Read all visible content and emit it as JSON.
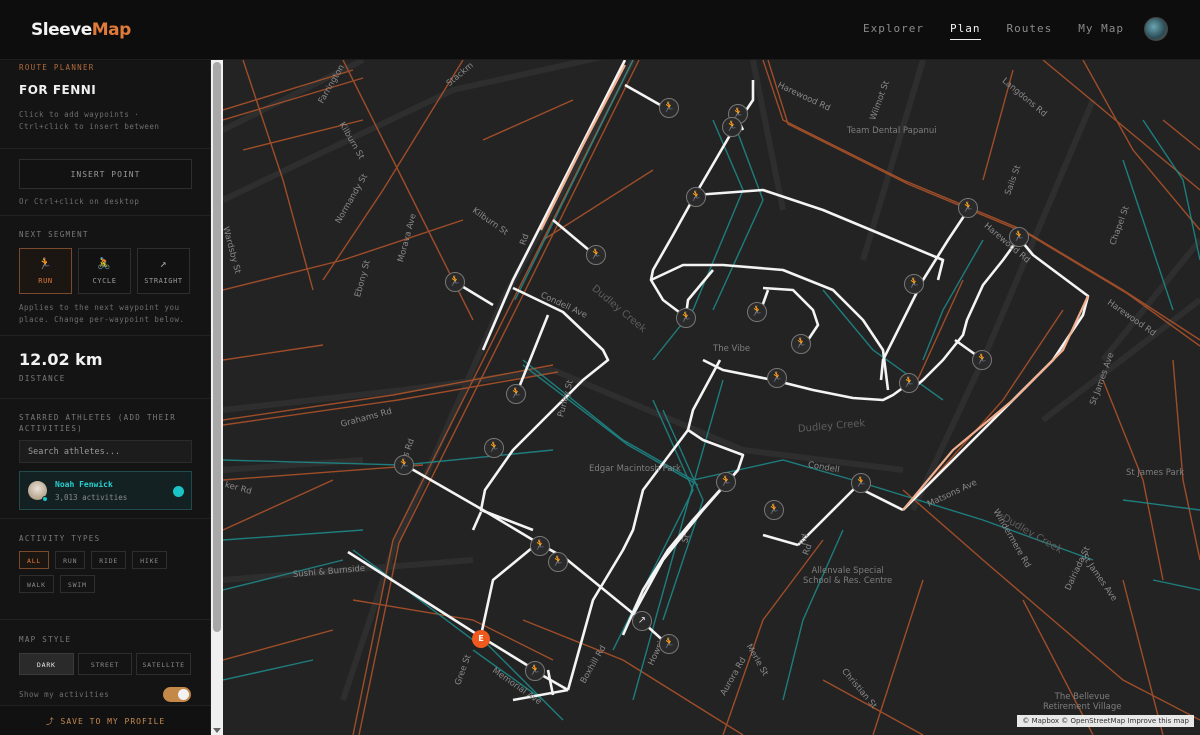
{
  "header": {
    "logo_part1": "Sleeve",
    "logo_part2": "Map",
    "nav": [
      "Explorer",
      "Plan",
      "Routes",
      "My Map"
    ],
    "active_nav": "Plan"
  },
  "sidebar": {
    "planner_label": "ROUTE PLANNER",
    "route_name": "FOR FENNI",
    "instructions": "Click to add waypoints · Ctrl+click to insert between",
    "insert_point_label": "INSERT POINT",
    "insert_hint": "Or Ctrl+click on desktop",
    "next_segment_label": "NEXT SEGMENT",
    "segments": [
      {
        "label": "RUN",
        "icon": "run-icon",
        "active": true
      },
      {
        "label": "CYCLE",
        "icon": "cycle-icon",
        "active": false
      },
      {
        "label": "STRAIGHT",
        "icon": "straight-icon",
        "active": false
      }
    ],
    "segment_hint": "Applies to the next waypoint you place. Change per-waypoint below.",
    "distance_value": "12.02 km",
    "distance_label": "DISTANCE",
    "starred_label": "STARRED ATHLETES (ADD THEIR ACTIVITIES)",
    "search_placeholder": "Search athletes...",
    "athlete": {
      "name": "Noah Fenwick",
      "activities": "3,013 activities"
    },
    "activity_types_label": "ACTIVITY TYPES",
    "activity_types": [
      "ALL",
      "RUN",
      "RIDE",
      "HIKE",
      "WALK",
      "SWIM"
    ],
    "activity_active": "ALL",
    "map_style_label": "MAP STYLE",
    "map_styles": [
      "DARK",
      "STREET",
      "SATELLITE"
    ],
    "map_style_active": "DARK",
    "show_activities_label": "Show my activities",
    "show_activities_on": true,
    "save_label": "⤴ SAVE TO MY PROFILE"
  },
  "map": {
    "streets": [
      {
        "name": "Farrington",
        "rot": -60
      },
      {
        "name": "Stackm",
        "rot": -40
      },
      {
        "name": "Kilburn St",
        "rot": 60
      },
      {
        "name": "Normandy St",
        "rot": -60
      },
      {
        "name": "Wardsby St",
        "rot": 75
      },
      {
        "name": "Ebony St",
        "rot": -75
      },
      {
        "name": "Morava Ave",
        "rot": -75
      },
      {
        "name": "Kilburn St",
        "rot": 35
      },
      {
        "name": "Rd",
        "rot": -70
      },
      {
        "name": "Harewood Rd",
        "rot": 25
      },
      {
        "name": "Wilmot St",
        "rot": -70
      },
      {
        "name": "Langdons Rd",
        "rot": 40
      },
      {
        "name": "Sails St",
        "rot": -70
      },
      {
        "name": "Harewood Rd",
        "rot": 40
      },
      {
        "name": "Chapel St",
        "rot": -70
      },
      {
        "name": "Harewood Rd",
        "rot": 35
      },
      {
        "name": "St James Ave",
        "rot": -70
      },
      {
        "name": "Condell Ave",
        "rot": 25
      },
      {
        "name": "Grahams Rd",
        "rot": -15
      },
      {
        "name": "Bres Rd",
        "rot": -70
      },
      {
        "name": "Purley St",
        "rot": -75
      },
      {
        "name": "Condell",
        "rot": 10
      },
      {
        "name": "Rd",
        "rot": -75
      },
      {
        "name": "Sushi & Burnside",
        "rot": -5
      },
      {
        "name": "Matsons Ave",
        "rot": -25
      },
      {
        "name": "Windermere Rd",
        "rot": 60
      },
      {
        "name": "Dalriada St",
        "rot": -65
      },
      {
        "name": "St James Ave",
        "rot": 55
      },
      {
        "name": "Aurora Rd",
        "rot": -60
      },
      {
        "name": "Howsi",
        "rot": -65
      },
      {
        "name": "Merle St",
        "rot": 60
      },
      {
        "name": "Memorial Ave",
        "rot": 35
      },
      {
        "name": "Christian St",
        "rot": 50
      },
      {
        "name": "ker Rd",
        "rot": 15
      },
      {
        "name": "Gree St",
        "rot": -70
      },
      {
        "name": "Rd",
        "rot": -70
      },
      {
        "name": "Boxhill Rd",
        "rot": -60
      },
      {
        "name": "St",
        "rot": -70
      }
    ],
    "pois": [
      "Team Dental Papanui",
      "The Vibe",
      "Edgar Macintosh Park",
      "Allenvale Special\nSchool & Res. Centre",
      "St James Park",
      "The Bellevue\nRetirement Village"
    ],
    "creeks": [
      "Dudley Creek",
      "Dudley Creek",
      "Dudley Creek"
    ],
    "end_marker": "E",
    "attribution": "© Mapbox © OpenStreetMap  Improve this map"
  }
}
